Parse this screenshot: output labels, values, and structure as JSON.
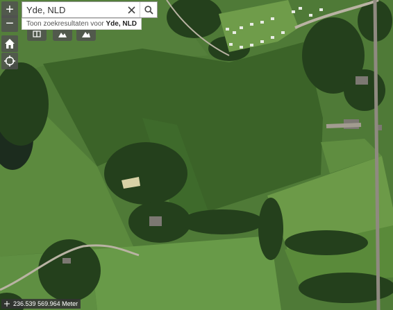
{
  "search": {
    "value": "Yde, NLD",
    "suggestion_prefix": "Toon zoekresultaten voor",
    "suggestion_term": "Yde, NLD"
  },
  "controls": {
    "zoom_in": "+",
    "zoom_out": "−"
  },
  "icons": {
    "clear": "close-icon",
    "search": "search-icon",
    "home": "home-icon",
    "locate": "locate-icon"
  },
  "coordinates": {
    "x": "236.539",
    "y": "569.964",
    "unit": "Meter"
  },
  "colors": {
    "field": "#3f6a2c",
    "control_bg": "#505050"
  }
}
